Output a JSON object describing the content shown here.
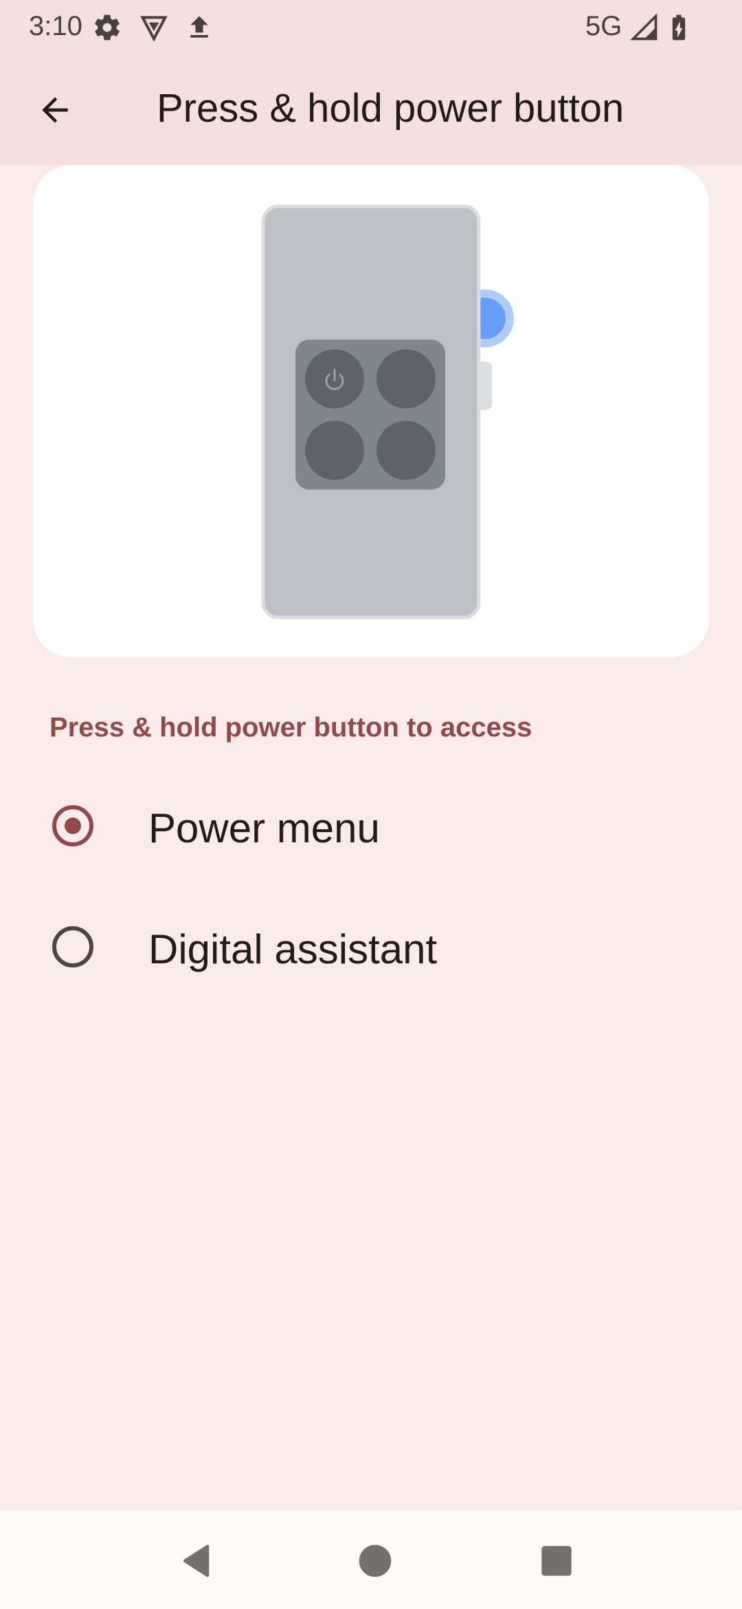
{
  "status_bar": {
    "time": "3:10",
    "network": "5G",
    "icons": [
      "gear-icon",
      "vpn-shield-icon",
      "upload-icon",
      "signal-icon",
      "battery-charging-icon"
    ]
  },
  "app_bar": {
    "title": "Press & hold power button",
    "back_icon": "arrow-back-icon"
  },
  "illustration": {
    "icons": [
      "phone-illustration",
      "power-icon"
    ]
  },
  "section": {
    "header": "Press & hold power button to access"
  },
  "options": [
    {
      "label": "Power menu",
      "selected": true
    },
    {
      "label": "Digital assistant",
      "selected": false
    }
  ],
  "nav_bar": {
    "buttons": [
      "back-triangle-icon",
      "home-circle-icon",
      "recents-square-icon"
    ]
  },
  "colors": {
    "background": "#fbeaea",
    "header_bg": "#f4dede",
    "accent": "#904848",
    "section_text": "#8f4a4a",
    "text": "#231a1a"
  }
}
